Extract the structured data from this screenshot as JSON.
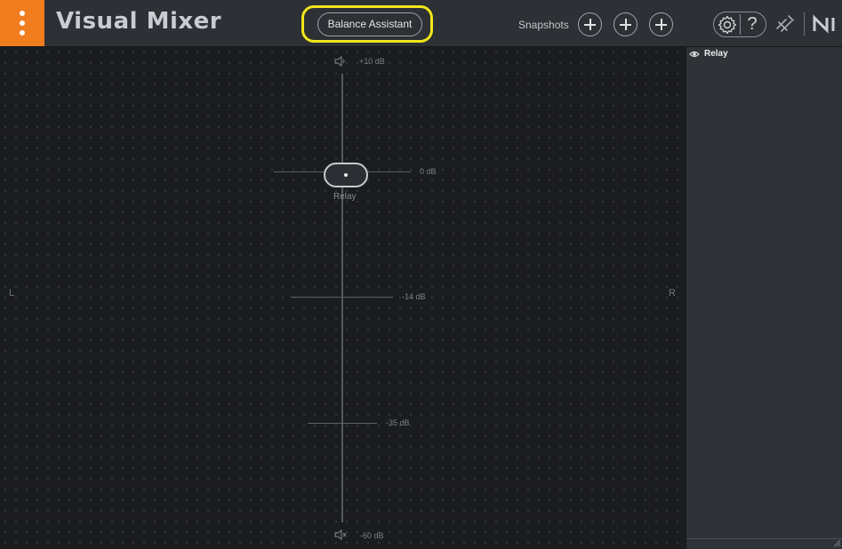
{
  "app": {
    "title": "Visual Mixer"
  },
  "header": {
    "balance_assistant_label": "Balance Assistant",
    "snapshots_label": "Snapshots",
    "snapshot_slots": [
      "+",
      "+",
      "+"
    ],
    "help_label": "?"
  },
  "stage": {
    "db_top": "+10 dB",
    "db_zero": "0 dB",
    "db_minus14": "-14 dB",
    "db_minus35": "-35 dB",
    "db_bottom": "-60 dB",
    "left_label": "L",
    "right_label": "R",
    "track_knob_label": "Relay"
  },
  "panel": {
    "tracks": [
      {
        "name": "Relay",
        "visible": true
      }
    ]
  },
  "colors": {
    "accent": "#f07d1e",
    "highlight": "#f2e51a"
  },
  "icons": [
    "menu-icon",
    "gear-icon",
    "help-icon",
    "plugin-link-icon",
    "ni-logo-icon",
    "speaker-icon",
    "speaker-mute-icon",
    "eye-icon",
    "resize-grip-icon"
  ]
}
